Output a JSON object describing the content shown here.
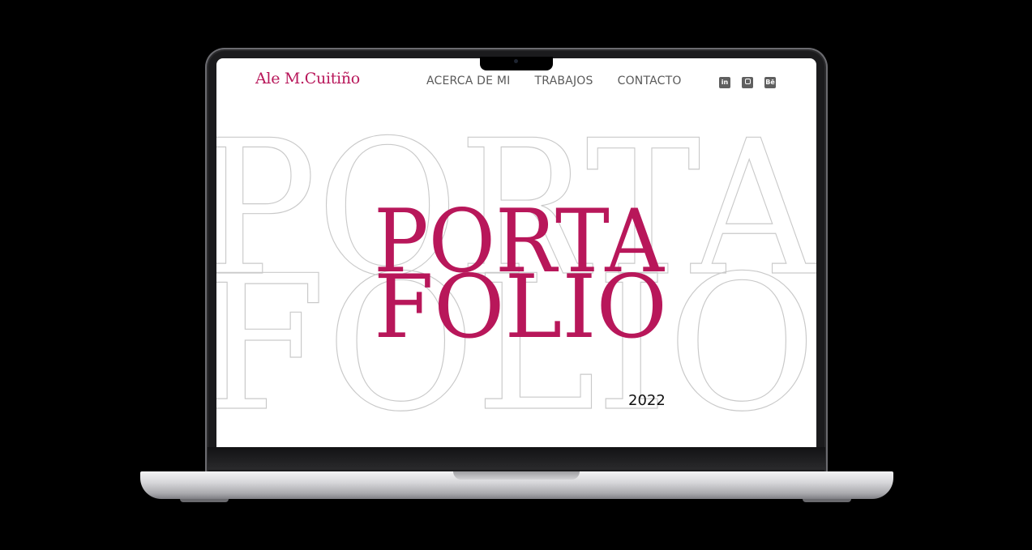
{
  "site": {
    "logo": "Ale M.Cuitiño",
    "nav": [
      "ACERCA DE MI",
      "TRABAJOS",
      "CONTACTO"
    ],
    "socials": [
      {
        "icon": "linkedin-icon",
        "glyph": "in"
      },
      {
        "icon": "instagram-icon",
        "glyph": ""
      },
      {
        "icon": "behance-icon",
        "glyph": "Bē"
      }
    ]
  },
  "hero": {
    "background_line1": "PORTA",
    "background_line2": "FOLIO",
    "title_line1": "PORTA",
    "title_line2": "FOLIO",
    "year": "2022"
  },
  "colors": {
    "accent": "#b8175a",
    "outline": "#c9c9c9",
    "nav_text": "#5a5a5a"
  }
}
